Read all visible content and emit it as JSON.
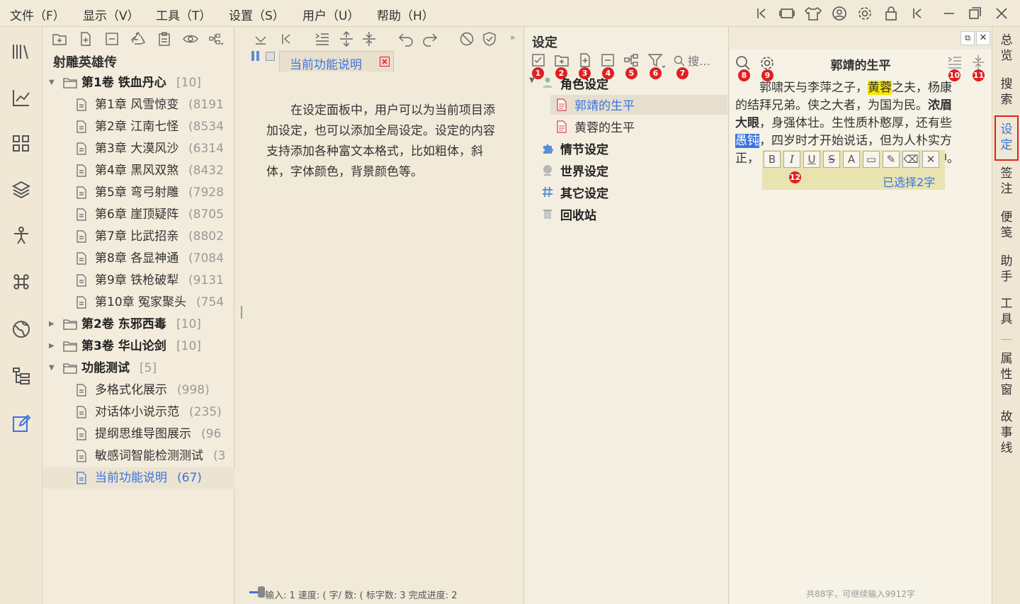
{
  "menu": {
    "file": "文件（F）",
    "view": "显示（V）",
    "tools": "工具（T）",
    "settings": "设置（S）",
    "user": "用户（U）",
    "help": "帮助（H）"
  },
  "book": {
    "title": "射雕英雄传",
    "rows": [
      {
        "kind": "volume",
        "label": "第1卷 铁血丹心",
        "count": "[10]",
        "expanded": true
      },
      {
        "kind": "chapter",
        "label": "第1章 风雪惊变",
        "count": "(8191"
      },
      {
        "kind": "chapter",
        "label": "第2章 江南七怪",
        "count": "(8534"
      },
      {
        "kind": "chapter",
        "label": "第3章 大漠风沙",
        "count": "(6314"
      },
      {
        "kind": "chapter",
        "label": "第4章 黑风双煞",
        "count": "(8432"
      },
      {
        "kind": "chapter",
        "label": "第5章 弯弓射雕",
        "count": "(7928"
      },
      {
        "kind": "chapter",
        "label": "第6章 崖顶疑阵",
        "count": "(8705"
      },
      {
        "kind": "chapter",
        "label": "第7章 比武招亲",
        "count": "(8802"
      },
      {
        "kind": "chapter",
        "label": "第8章 各显神通",
        "count": "(7084"
      },
      {
        "kind": "chapter",
        "label": "第9章 铁枪破犁",
        "count": "(9131"
      },
      {
        "kind": "chapter",
        "label": "第10章 冤家聚头",
        "count": "(754"
      },
      {
        "kind": "volume",
        "label": "第2卷 东邪西毒",
        "count": "[10]",
        "expanded": false
      },
      {
        "kind": "volume",
        "label": "第3卷 华山论剑",
        "count": "[10]",
        "expanded": false
      },
      {
        "kind": "volume",
        "label": "功能测试",
        "count": "[5]",
        "expanded": true
      },
      {
        "kind": "chapter",
        "label": "多格式化展示",
        "count": "(998)"
      },
      {
        "kind": "chapter",
        "label": "对话体小说示范",
        "count": "(235)"
      },
      {
        "kind": "chapter",
        "label": "提纲思维导图展示",
        "count": "(96"
      },
      {
        "kind": "chapter",
        "label": "敏感词智能检测测试",
        "count": "(3"
      },
      {
        "kind": "chapter",
        "label": "当前功能说明",
        "count": "(67)",
        "active": true
      }
    ]
  },
  "editor": {
    "tab_label": "当前功能说明",
    "body": "在设定面板中，用户可以为当前项目添加设定，也可以添加全局设定。设定的内容支持添加各种富文本格式，比如粗体，斜体，字体颜色，背景颜色等。",
    "status": "输入: 1  速度: ( 字/  数: ( 标字数: 3 完成进度: 2"
  },
  "settings": {
    "title": "设定",
    "search_placeholder": "搜…",
    "badges": [
      "1",
      "2",
      "3",
      "4",
      "5",
      "6",
      "7"
    ],
    "tree": [
      {
        "label": "角色设定",
        "kind": "group"
      },
      {
        "label": "郭靖的生平",
        "kind": "doc",
        "selected": true
      },
      {
        "label": "黄蓉的生平",
        "kind": "doc"
      },
      {
        "label": "情节设定",
        "kind": "group"
      },
      {
        "label": "世界设定",
        "kind": "group"
      },
      {
        "label": "其它设定",
        "kind": "group"
      },
      {
        "label": "回收站",
        "kind": "group"
      }
    ]
  },
  "detail": {
    "title": "郭靖的生平",
    "badges": [
      "8",
      "9",
      "10",
      "11",
      "12"
    ],
    "line1_a": "郭啸天与李萍之子，",
    "line1_hl": "黄蓉",
    "line1_b": "之夫，杨康",
    "line2_a": "的结拜兄弟。侠之大者，为国为民。",
    "line2_bold": "浓眉",
    "line3_bold": "大眼",
    "line3_b": "，身强体壮。生性质朴憨厚，还有些",
    "line4_sel": "愚钝",
    "line4_b": "，四岁时才开始说话，但为人朴实方",
    "line5_a": "正，",
    "line5_b": "神。",
    "selection_info": "已选择2字",
    "footer": "共88字，可继续输入9912字"
  },
  "rightbar": {
    "items": [
      "总览",
      "搜索",
      "设定",
      "签注",
      "便笺",
      "助手",
      "工具",
      "属性窗",
      "故事线"
    ]
  },
  "colors": {
    "accent": "#3a73e0",
    "badge": "#e02020",
    "highlight": "#f6e600"
  }
}
